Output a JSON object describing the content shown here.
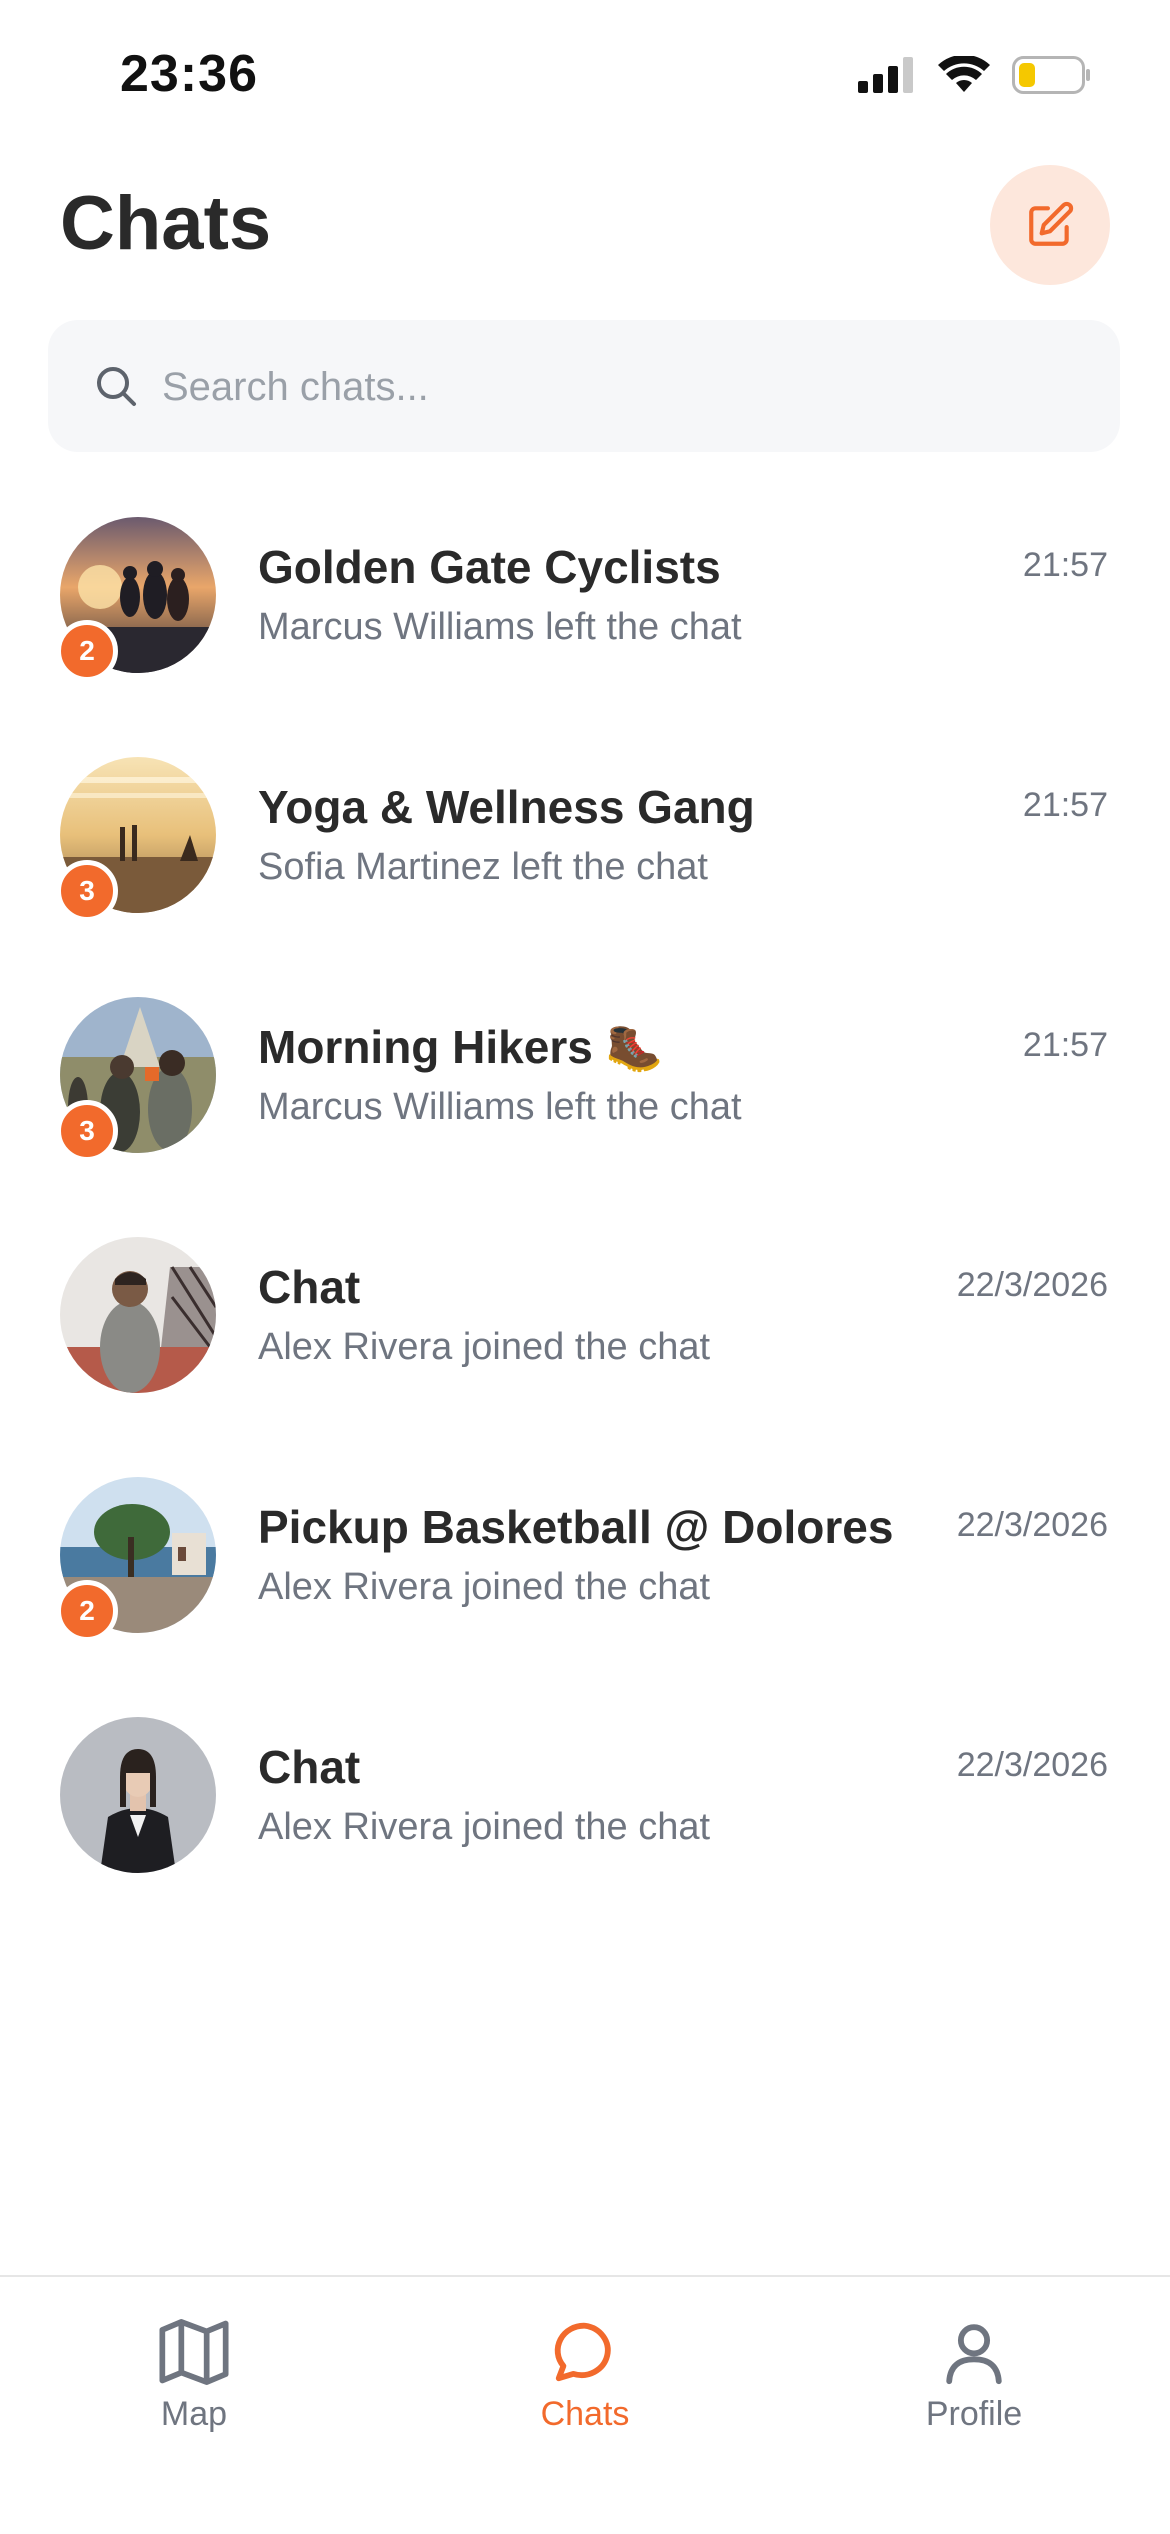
{
  "status_bar": {
    "time": "23:36"
  },
  "header": {
    "title": "Chats"
  },
  "search": {
    "placeholder": "Search chats..."
  },
  "chats": [
    {
      "name": "Golden Gate Cyclists",
      "preview": "Marcus Williams left the chat",
      "time": "21:57",
      "unread": "2",
      "avatar": "cyclists-photo"
    },
    {
      "name": "Yoga & Wellness Gang",
      "preview": "Sofia Martinez left the chat",
      "time": "21:57",
      "unread": "3",
      "avatar": "beach-yoga-photo"
    },
    {
      "name": "Morning Hikers 🥾",
      "preview": "Marcus Williams left the chat",
      "time": "21:57",
      "unread": "3",
      "avatar": "hikers-photo"
    },
    {
      "name": "Chat",
      "preview": "Alex Rivera joined the chat",
      "time": "22/3/2026",
      "unread": "",
      "avatar": "man-bridge-photo"
    },
    {
      "name": "Pickup Basketball @ Dolores",
      "preview": "Alex Rivera joined the chat",
      "time": "22/3/2026",
      "unread": "2",
      "avatar": "basketball-court-photo"
    },
    {
      "name": "Chat",
      "preview": "Alex Rivera joined the chat",
      "time": "22/3/2026",
      "unread": "",
      "avatar": "woman-suit-photo"
    }
  ],
  "tabs": [
    {
      "label": "Map",
      "icon": "map-icon",
      "active": false
    },
    {
      "label": "Chats",
      "icon": "chat-bubble-icon",
      "active": true
    },
    {
      "label": "Profile",
      "icon": "person-icon",
      "active": false
    }
  ],
  "colors": {
    "accent": "#f26a2c",
    "accent_soft": "#fde7dc",
    "text_primary": "#2a2a2a",
    "text_secondary": "#6f7580"
  }
}
